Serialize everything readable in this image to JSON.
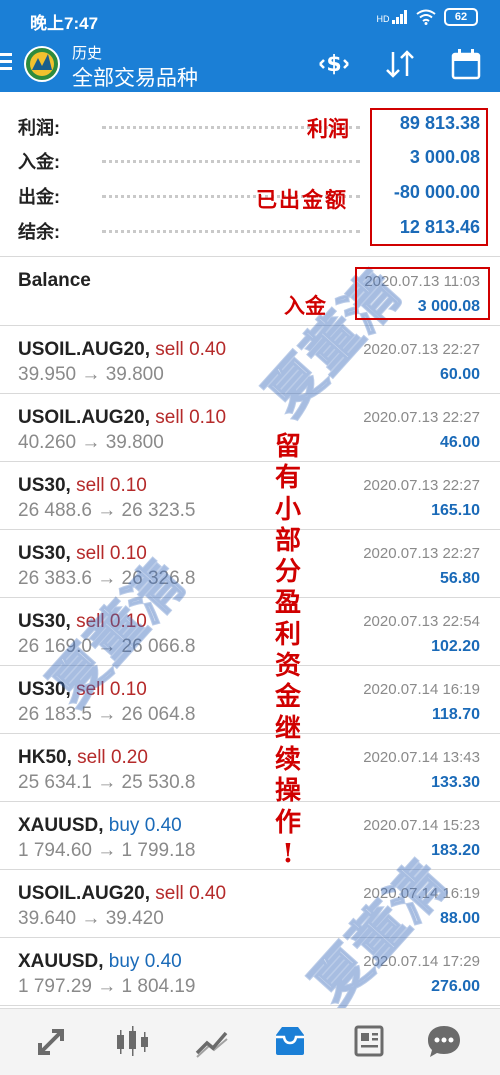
{
  "status_bar": {
    "time": "晚上7:47",
    "signal_label": "HD",
    "battery": "62"
  },
  "app_bar": {
    "title": "历史",
    "subtitle": "全部交易品种"
  },
  "summary": [
    {
      "label": "利润:",
      "value": "89 813.38"
    },
    {
      "label": "入金:",
      "value": "3 000.08"
    },
    {
      "label": "出金:",
      "value": "-80 000.00"
    },
    {
      "label": "结余:",
      "value": "12 813.46"
    }
  ],
  "balance": {
    "label": "Balance",
    "date": "2020.07.13 11:03",
    "amount": "3 000.08"
  },
  "transactions": [
    {
      "symbol": "USOIL.AUG20,",
      "side": "sell",
      "volume": "0.40",
      "open": "39.950",
      "close": "39.800",
      "date": "2020.07.13 22:27",
      "profit": "60.00"
    },
    {
      "symbol": "USOIL.AUG20,",
      "side": "sell",
      "volume": "0.10",
      "open": "40.260",
      "close": "39.800",
      "date": "2020.07.13 22:27",
      "profit": "46.00"
    },
    {
      "symbol": "US30,",
      "side": "sell",
      "volume": "0.10",
      "open": "26 488.6",
      "close": "26 323.5",
      "date": "2020.07.13 22:27",
      "profit": "165.10"
    },
    {
      "symbol": "US30,",
      "side": "sell",
      "volume": "0.10",
      "open": "26 383.6",
      "close": "26 326.8",
      "date": "2020.07.13 22:27",
      "profit": "56.80"
    },
    {
      "symbol": "US30,",
      "side": "sell",
      "volume": "0.10",
      "open": "26 169.0",
      "close": "26 066.8",
      "date": "2020.07.13 22:54",
      "profit": "102.20"
    },
    {
      "symbol": "US30,",
      "side": "sell",
      "volume": "0.10",
      "open": "26 183.5",
      "close": "26 064.8",
      "date": "2020.07.14 16:19",
      "profit": "118.70"
    },
    {
      "symbol": "HK50,",
      "side": "sell",
      "volume": "0.20",
      "open": "25 634.1",
      "close": "25 530.8",
      "date": "2020.07.14 13:43",
      "profit": "133.30"
    },
    {
      "symbol": "XAUUSD,",
      "side": "buy",
      "volume": "0.40",
      "open": "1 794.60",
      "close": "1 799.18",
      "date": "2020.07.14 15:23",
      "profit": "183.20"
    },
    {
      "symbol": "USOIL.AUG20,",
      "side": "sell",
      "volume": "0.40",
      "open": "39.640",
      "close": "39.420",
      "date": "2020.07.14 16:19",
      "profit": "88.00"
    },
    {
      "symbol": "XAUUSD,",
      "side": "buy",
      "volume": "0.40",
      "open": "1 797.29",
      "close": "1 804.19",
      "date": "2020.07.14 17:29",
      "profit": "276.00"
    }
  ],
  "annotations": {
    "profit": "利润",
    "withdrawn": "已出金额",
    "deposit": "入金",
    "note": "留有小部分盈利资金继续操作!"
  },
  "watermark": "夏董清",
  "arrow": "→",
  "colors": {
    "accent": "#1b7fd6",
    "value_blue": "#1a6ab8",
    "sell_red": "#b52a2a",
    "annotation_red": "#d00000"
  },
  "bottom_nav": [
    {
      "icon": "trade-icon"
    },
    {
      "icon": "quotes-candles-icon"
    },
    {
      "icon": "chart-icon"
    },
    {
      "icon": "history-inbox-icon"
    },
    {
      "icon": "news-icon"
    },
    {
      "icon": "chat-icon"
    }
  ]
}
